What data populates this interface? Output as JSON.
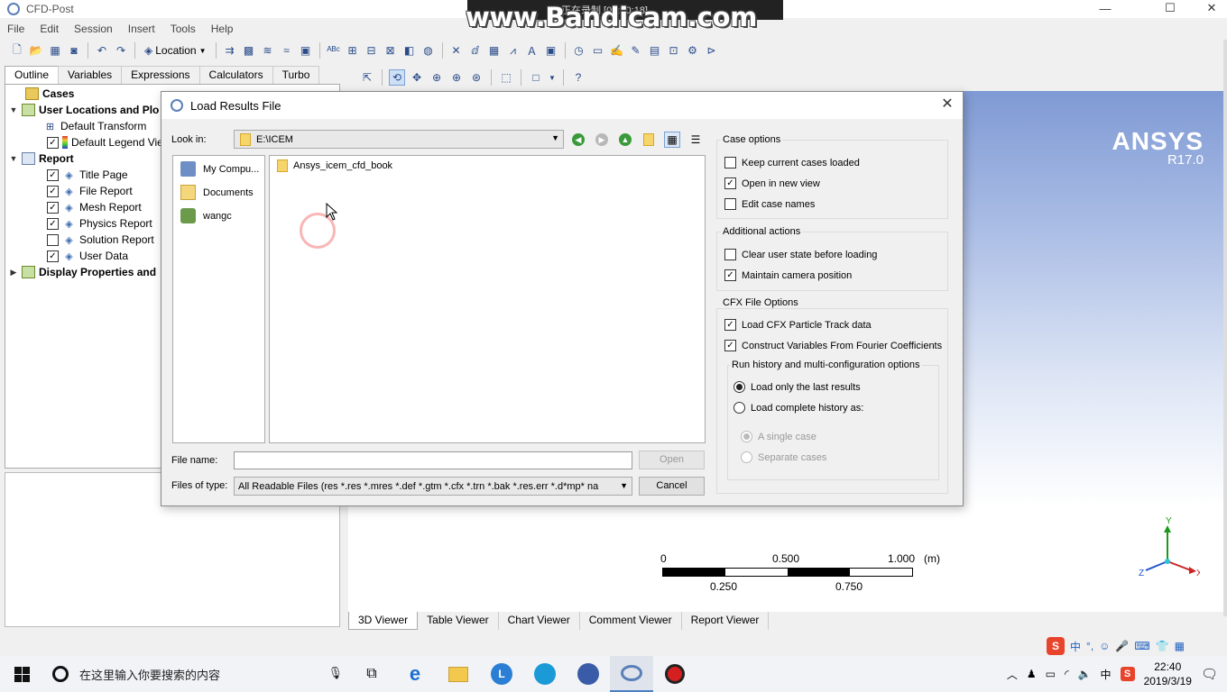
{
  "window": {
    "title": "CFD-Post",
    "min_glyph": "—",
    "max_glyph": "☐",
    "close_glyph": "✕"
  },
  "bandicam": {
    "recording_text": "正在录制 [00:00:18]",
    "watermark": "www.Bandicam.com"
  },
  "menu": [
    "File",
    "Edit",
    "Session",
    "Insert",
    "Tools",
    "Help"
  ],
  "toolbar": {
    "location_label": "Location"
  },
  "left_tabs": [
    "Outline",
    "Variables",
    "Expressions",
    "Calculators",
    "Turbo"
  ],
  "outline": {
    "cases": "Cases",
    "user_locations": "User Locations and Plo",
    "default_transform": "Default Transform",
    "default_legend": "Default Legend Vie",
    "report": "Report",
    "report_items": [
      {
        "label": "Title Page",
        "checked": true
      },
      {
        "label": "File Report",
        "checked": true
      },
      {
        "label": "Mesh Report",
        "checked": true
      },
      {
        "label": "Physics Report",
        "checked": true
      },
      {
        "label": "Solution Report",
        "checked": false
      },
      {
        "label": "User Data",
        "checked": true
      }
    ],
    "display_props": "Display Properties and"
  },
  "viewer": {
    "brand": "ANSYS",
    "version": "R17.0",
    "scale": {
      "top_left": "0",
      "top_mid": "0.500",
      "top_right": "1.000",
      "unit": "(m)",
      "bottom_left": "0.250",
      "bottom_right": "0.750"
    },
    "axes": {
      "y": "Y",
      "x": "X",
      "z": "Z"
    },
    "tabs": [
      "3D Viewer",
      "Table Viewer",
      "Chart Viewer",
      "Comment Viewer",
      "Report Viewer"
    ]
  },
  "dialog": {
    "title": "Load Results File",
    "look_in_label": "Look in:",
    "look_in_value": "E:\\ICEM",
    "places": [
      "My Compu...",
      "Documents",
      "wangc"
    ],
    "files": [
      "Ansys_icem_cfd_book"
    ],
    "file_name_label": "File name:",
    "file_name_value": "",
    "files_of_type_label": "Files of type:",
    "files_of_type_value": "All Readable Files (res *.res *.mres *.def *.gtm *.cfx *.trn *.bak *.res.err *.d*mp* na",
    "open_label": "Open",
    "cancel_label": "Cancel",
    "case_options_title": "Case options",
    "case_options": [
      {
        "label": "Keep current cases loaded",
        "checked": false
      },
      {
        "label": "Open in new view",
        "checked": true
      },
      {
        "label": "Edit case names",
        "checked": false
      }
    ],
    "additional_title": "Additional actions",
    "additional": [
      {
        "label": "Clear user state before loading",
        "checked": false
      },
      {
        "label": "Maintain camera position",
        "checked": true
      }
    ],
    "cfx_title": "CFX File Options",
    "cfx": [
      {
        "label": "Load CFX Particle Track data",
        "checked": true
      },
      {
        "label": "Construct Variables From Fourier Coefficients",
        "checked": true
      }
    ],
    "history_title": "Run history and multi-configuration options",
    "history": [
      {
        "label": "Load only the last results",
        "selected": true
      },
      {
        "label": "Load complete history as:",
        "selected": false
      }
    ],
    "history_sub": [
      {
        "label": "A single case",
        "selected": true
      },
      {
        "label": "Separate cases",
        "selected": false
      }
    ]
  },
  "taskbar": {
    "search_placeholder": "在这里输入你要搜索的内容",
    "time": "22:40",
    "date": "2019/3/19",
    "ime_lang": "中"
  },
  "colors": {
    "accent": "#4a7fc1",
    "viewer_top": "#7f9ad4",
    "brand_text": "#ffffff"
  }
}
